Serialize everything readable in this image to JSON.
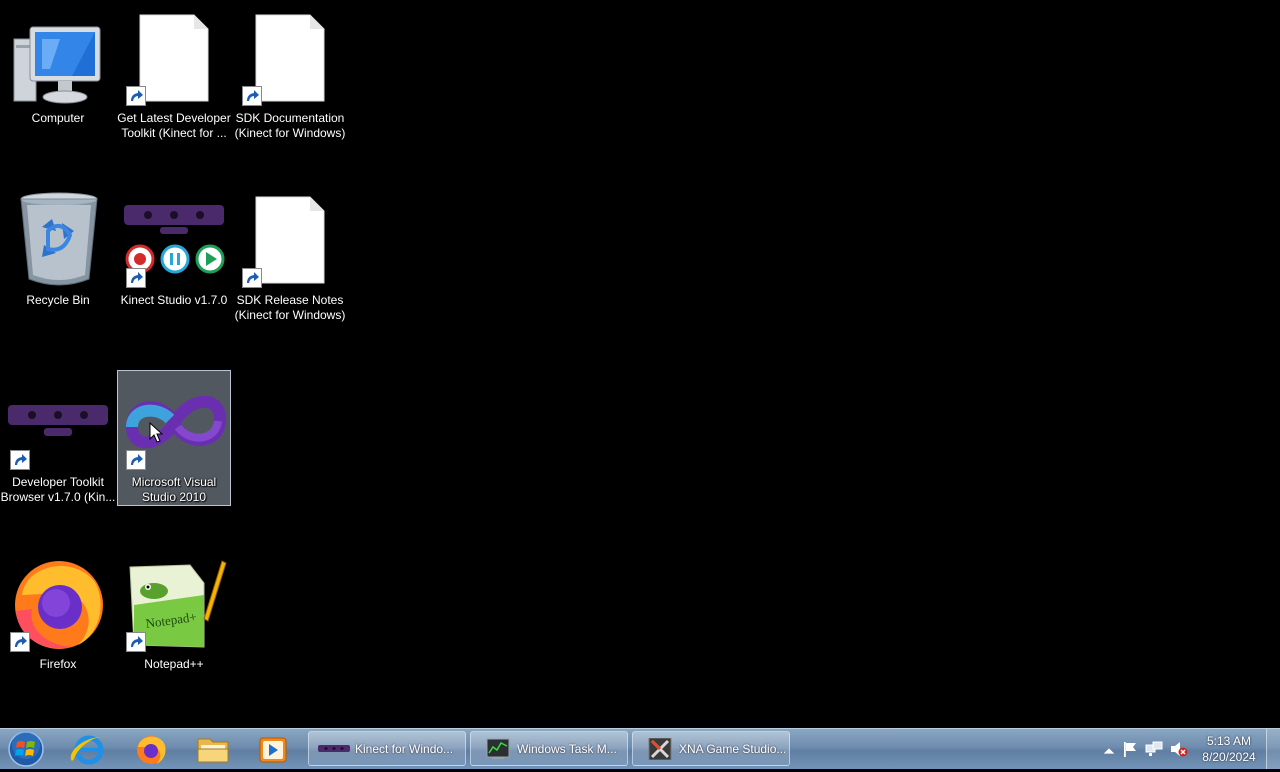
{
  "desktop": {
    "icons": {
      "computer": {
        "label": "Computer"
      },
      "get_latest": {
        "label_line1": "Get Latest Developer",
        "label_line2": "Toolkit (Kinect for ..."
      },
      "sdk_docs": {
        "label_line1": "SDK Documentation",
        "label_line2": "(Kinect for Windows)"
      },
      "recycle_bin": {
        "label": "Recycle Bin"
      },
      "kinect_studio": {
        "label": "Kinect Studio v1.7.0"
      },
      "sdk_release_notes": {
        "label_line1": "SDK Release Notes",
        "label_line2": "(Kinect for Windows)"
      },
      "dev_toolkit_browser": {
        "label_line1": "Developer Toolkit",
        "label_line2": "Browser v1.7.0 (Kin..."
      },
      "visual_studio": {
        "label_line1": "Microsoft Visual",
        "label_line2": "Studio 2010",
        "selected": true
      },
      "firefox": {
        "label": "Firefox"
      },
      "notepadpp": {
        "label": "Notepad++"
      }
    }
  },
  "taskbar": {
    "start": {
      "icon": "windows-start-orb"
    },
    "pinned": [
      {
        "name": "Internet Explorer",
        "icon": "internet-explorer-icon"
      },
      {
        "name": "Firefox",
        "icon": "firefox-icon"
      },
      {
        "name": "Windows Explorer",
        "icon": "folder-icon"
      },
      {
        "name": "Windows Media Player",
        "icon": "media-player-icon"
      }
    ],
    "tasks": [
      {
        "label": "Kinect for Windo...",
        "icon": "kinect-sensor-icon"
      },
      {
        "label": "Windows Task M...",
        "icon": "task-manager-icon"
      },
      {
        "label": "XNA Game Studio...",
        "icon": "xna-icon"
      }
    ],
    "tray": {
      "icons": [
        "show-hidden-icons-arrow",
        "action-center-flag-icon",
        "network-icon",
        "volume-muted-icon"
      ]
    },
    "clock": {
      "time": "5:13 AM",
      "date": "8/20/2024"
    }
  },
  "colors": {
    "desktop_background": "#000000",
    "selection": "#96a0af",
    "kinect_purple": "#4b2a6b",
    "taskbar": "#6e8cae"
  }
}
